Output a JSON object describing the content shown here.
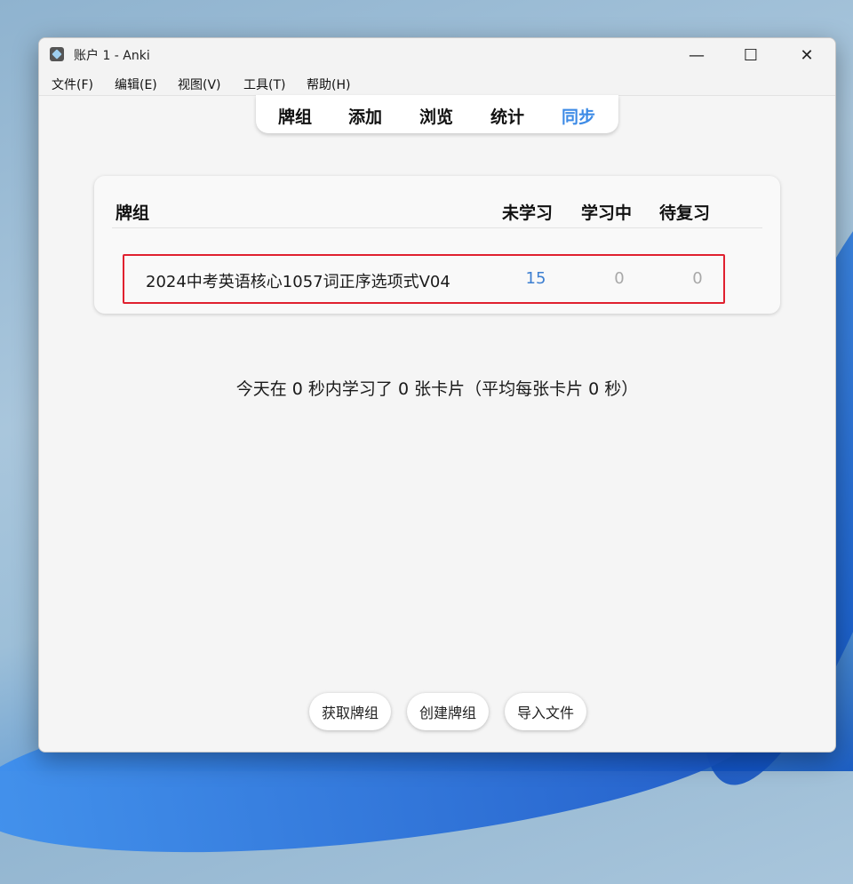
{
  "window": {
    "title": "账户 1 - Anki",
    "controls": {
      "minimize": "—",
      "maximize": "☐",
      "close": "✕"
    }
  },
  "menubar": {
    "items": [
      "文件(F)",
      "编辑(E)",
      "视图(V)",
      "工具(T)",
      "帮助(H)"
    ]
  },
  "toolbar": {
    "tabs": [
      "牌组",
      "添加",
      "浏览",
      "统计",
      "同步"
    ],
    "active": "同步"
  },
  "deck_table": {
    "headers": {
      "deck": "牌组",
      "new": "未学习",
      "learning": "学习中",
      "review": "待复习"
    },
    "rows": [
      {
        "name": "2024中考英语核心1057词正序选项式V04",
        "new": "15",
        "learning": "0",
        "review": "0"
      }
    ]
  },
  "study_summary": "今天在 0 秒内学习了 0 张卡片（平均每张卡片 0 秒）",
  "buttons": {
    "get_shared": "获取牌组",
    "create_deck": "创建牌组",
    "import_file": "导入文件"
  },
  "colors": {
    "active_tab": "#3d8be6",
    "new_count": "#3d7fd1",
    "zero_count": "#a8a8a8",
    "highlight_box": "#e0212f"
  },
  "icons": [
    "anki-app-icon",
    "minimize-icon",
    "maximize-icon",
    "close-icon"
  ]
}
